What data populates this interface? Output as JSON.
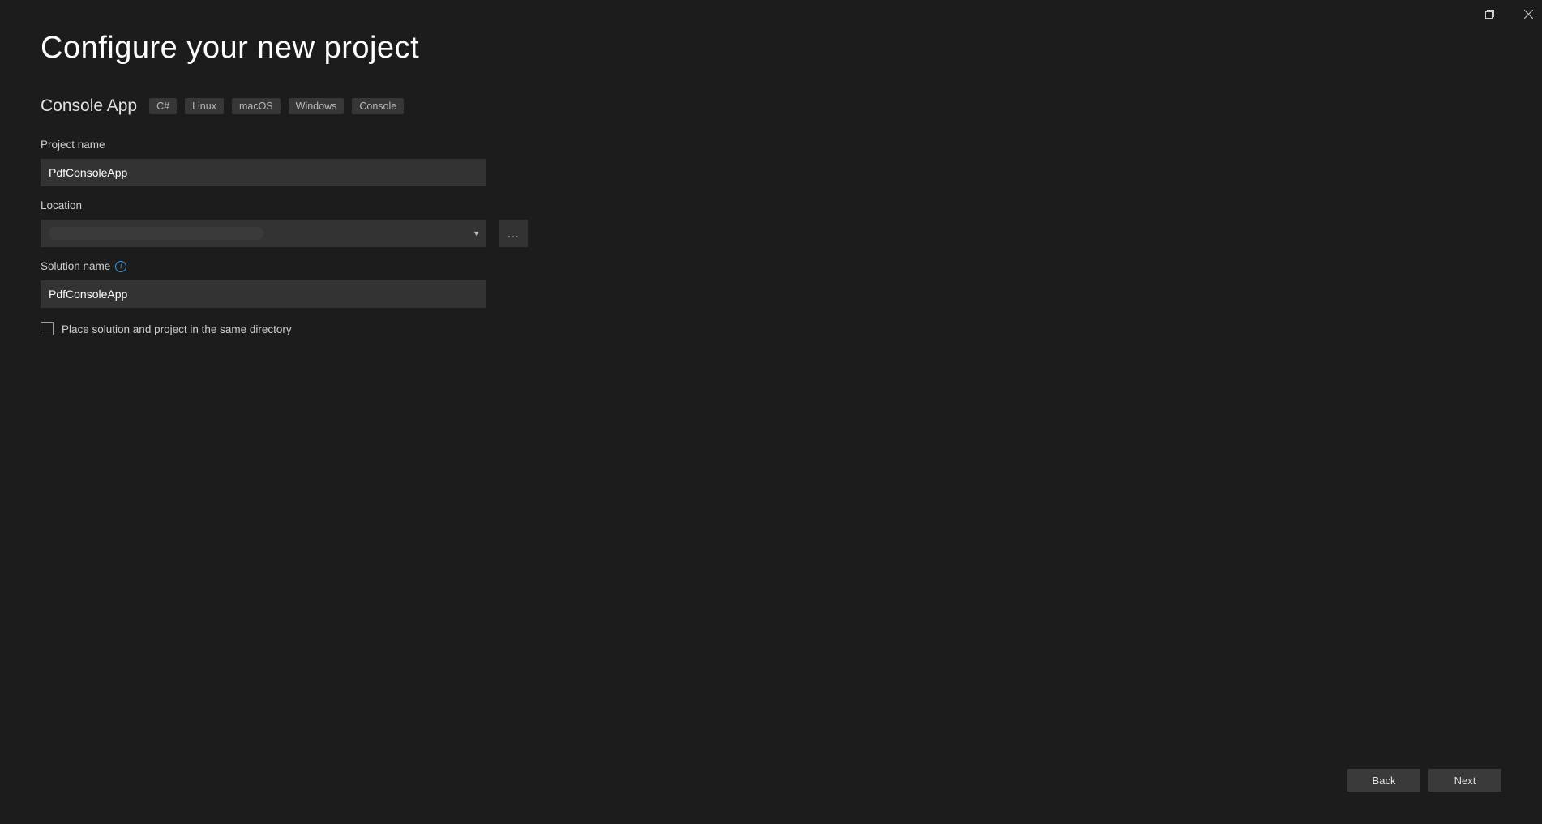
{
  "titlebar": {
    "maximize_label": "maximize",
    "close_label": "close"
  },
  "header": {
    "title": "Configure your new project",
    "template_name": "Console App",
    "tags": [
      "C#",
      "Linux",
      "macOS",
      "Windows",
      "Console"
    ]
  },
  "form": {
    "project_name": {
      "label": "Project name",
      "value": "PdfConsoleApp"
    },
    "location": {
      "label": "Location",
      "browse_label": "..."
    },
    "solution_name": {
      "label": "Solution name",
      "value": "PdfConsoleApp",
      "info_tooltip": "i"
    },
    "same_dir_checkbox": {
      "label": "Place solution and project in the same directory",
      "checked": false
    }
  },
  "footer": {
    "back_label": "Back",
    "next_label": "Next"
  }
}
